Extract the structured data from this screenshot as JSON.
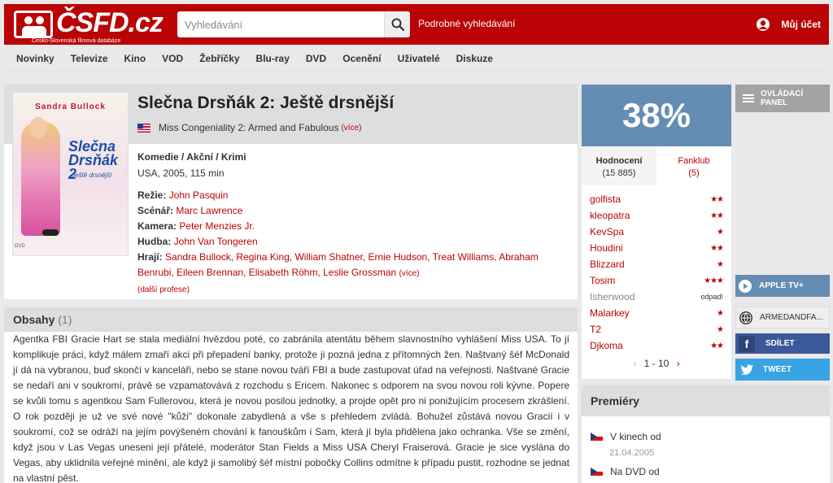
{
  "header": {
    "logo_text": "ČSFD.cz",
    "logo_tagline": "Česko-Slovenská filmová databáze",
    "search_placeholder": "Vyhledávání",
    "advanced_search": "Podrobné vyhledávání",
    "account": "Můj účet"
  },
  "nav": [
    "Novinky",
    "Televize",
    "Kino",
    "VOD",
    "Žebříčky",
    "Blu-ray",
    "DVD",
    "Ocenění",
    "Uživatelé",
    "Diskuze"
  ],
  "film": {
    "title": "Slečna Drsňák 2: Ještě drsnější",
    "alt_title": "Miss Congeniality 2: Armed and Fabulous",
    "alt_more": "(více)",
    "genres": "Komedie / Akční / Krimi",
    "origin": "USA, 2005, 115 min",
    "poster": {
      "actor": "Sandra Bullock",
      "title_line1": "Slečna",
      "title_line2": "Drsňák 2",
      "subtitle": "Ještě drsnější",
      "dvd": "DVD"
    },
    "credits": {
      "directing_label": "Režie:",
      "directing": "John Pasquin",
      "screenplay_label": "Scénář:",
      "screenplay": "Marc Lawrence",
      "camera_label": "Kamera:",
      "camera": "Peter Menzies Jr.",
      "music_label": "Hudba:",
      "music": "John Van Tongeren",
      "cast_label": "Hrají:",
      "cast": "Sandra Bullock, Regina King, William Shatner, Ernie Hudson, Treat Williams, Abraham Benrubi, Eileen Brennan, Elisabeth Röhm, Leslie Grossman",
      "cast_more": "(více)",
      "more_professions": "(další profese)"
    }
  },
  "plot": {
    "heading": "Obsahy",
    "count": "(1)",
    "text": "Agentka FBI Gracie Hart se stala mediální hvězdou poté, co zabránila atentátu během slavnostního vyhlášení Miss USA. To jí komplikuje práci, když málem zmaří akci při přepadení banky, protože ji pozná jedna z přítomných žen. Naštvaný šéf McDonald jí dá na vybranou, buď skončí v kanceláři, nebo se stane novou tváří FBI a bude zastupovat úřad na veřejnosti. Naštvané Gracie se nedaří ani v soukromí, právě se vzpamatovává z rozchodu s Ericem. Nakonec s odporem na svou novou roli kývne. Popere se kvůli tomu s agentkou Sam Fullerovou, která je novou posilou jednotky, a projde opět pro ni ponižujícím procesem zkrášlení. O rok později je už ve své nové \"kůži\" dokonale zabydlená a vše s přehledem zvládá. Bohužel zůstává novou Gracií i v soukromí, což se odráží na jejím povýšeném chování k fanouškům i Sam, která jí byla přidělena jako ochranka. Vše se změní, když jsou v Las Vegas uneseni její přátelé, moderátor Stan Fields a Miss USA Cheryl Fraiserová. Gracie je sice vyslána do Vegas, aby uklidnila veřejné mínění, ale když ji samolibý šéf místní pobočky Collins odmítne k případu pustit, rozhodne se jednat na vlastní pěst."
  },
  "rating": {
    "percent": "38%",
    "color": "#658db3",
    "tab_ratings_label": "Hodnocení",
    "tab_ratings_count": "(15 885)",
    "tab_fanclub_label": "Fanklub",
    "tab_fanclub_count": "(5)",
    "users": [
      {
        "name": "golfista",
        "stars": "★★"
      },
      {
        "name": "kleopatra",
        "stars": "★★"
      },
      {
        "name": "KevSpa",
        "stars": "★"
      },
      {
        "name": "Houdini",
        "stars": "★★"
      },
      {
        "name": "Blizzard",
        "stars": "★"
      },
      {
        "name": "Tosim",
        "stars": "★★★"
      },
      {
        "name": "Isherwood",
        "stars": "odpad!"
      },
      {
        "name": "Malarkey",
        "stars": "★"
      },
      {
        "name": "T2",
        "stars": "★"
      },
      {
        "name": "Djkoma",
        "stars": "★★"
      }
    ],
    "pager": "1 - 10",
    "pager_prev": "‹",
    "pager_next": "›"
  },
  "premieres": {
    "heading": "Premiéry",
    "cinema_label": "V kinech od",
    "cinema_date": "21.04.2005",
    "dvd_label": "Na DVD od"
  },
  "side": {
    "control_panel_line1": "OVLÁDACÍ",
    "control_panel_line2": "PANEL",
    "apple_tv": "APPLE TV+",
    "web": "ARMEDANDFA...",
    "share": "SDÍLET",
    "tweet": "TWEET",
    "fb_letter": "f"
  }
}
